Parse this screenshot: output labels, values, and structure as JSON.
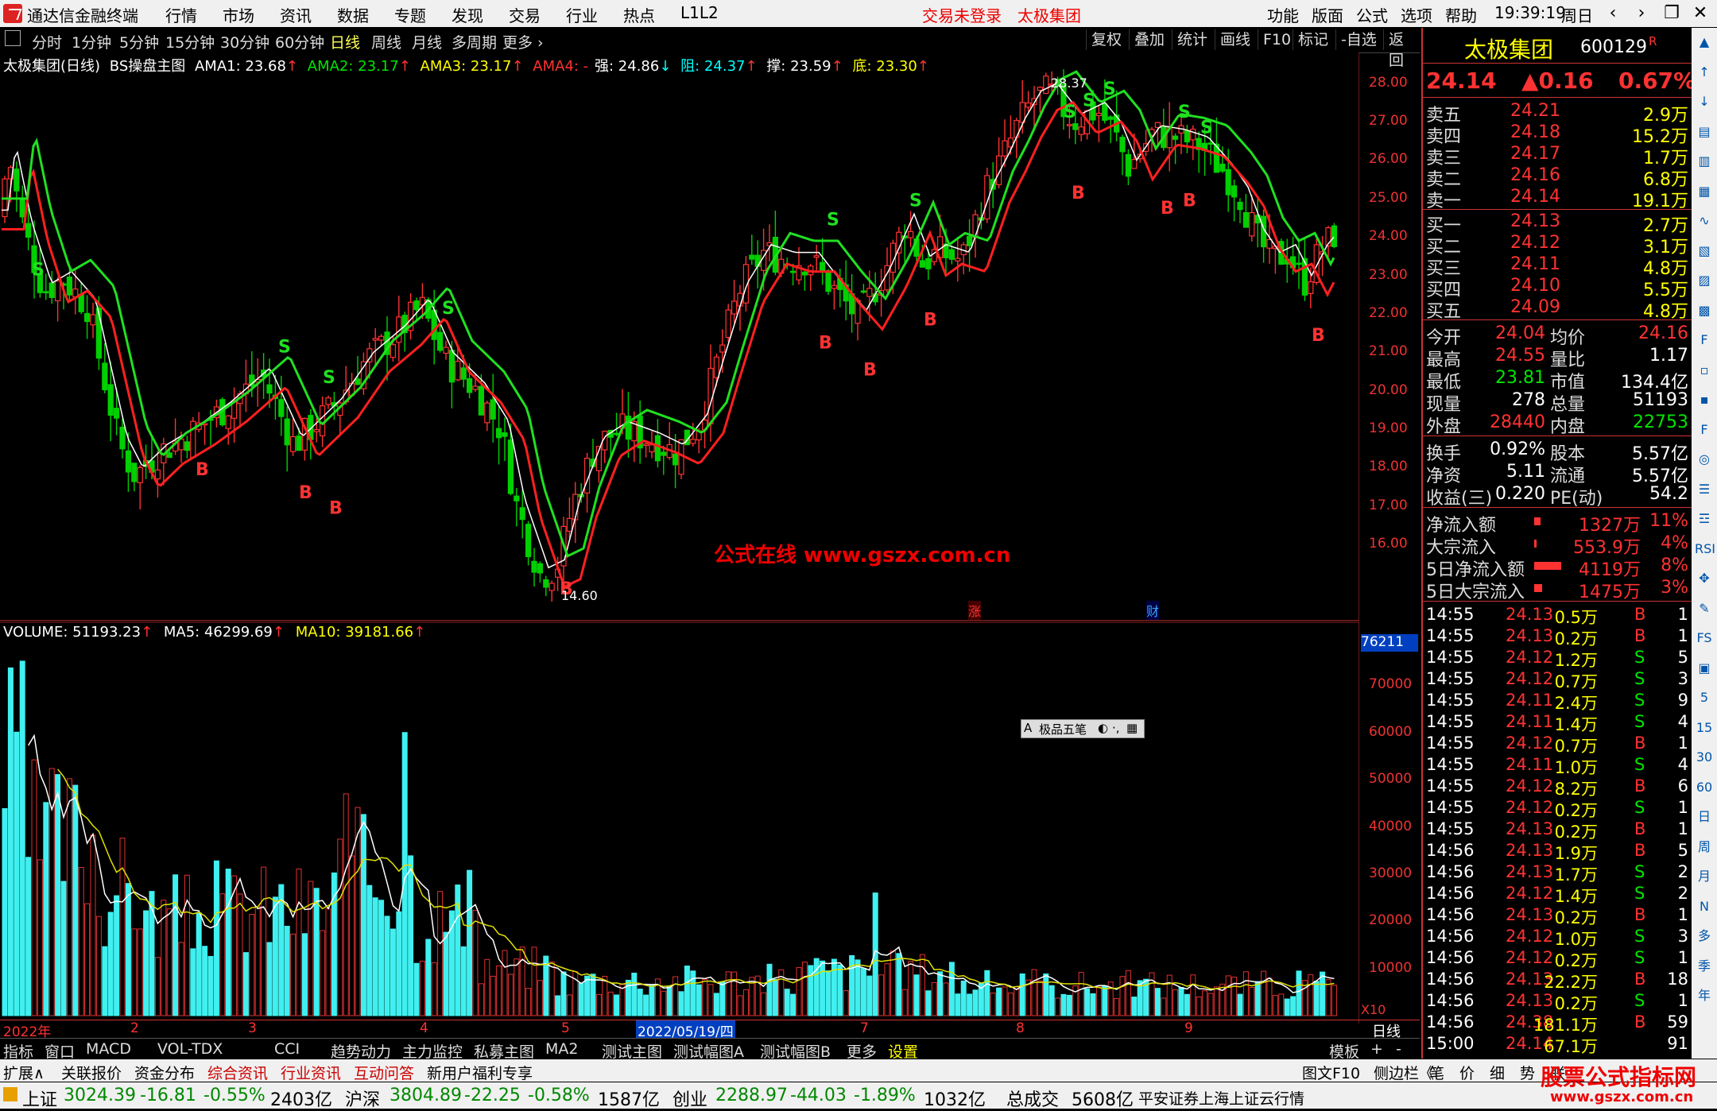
{
  "window": {
    "app_title": "通达信金融终端",
    "menus": [
      "行情",
      "市场",
      "资讯",
      "数据",
      "专题",
      "发现",
      "交易",
      "行业",
      "热点",
      "L1L2"
    ],
    "login_status": "交易未登录",
    "stock_title": "太极集团",
    "right_menus": [
      "功能",
      "版面",
      "公式",
      "选项",
      "帮助"
    ],
    "clock": "19:39:19",
    "weekday": "周日",
    "window_buttons": [
      "‹",
      "›",
      "❐",
      "✕"
    ]
  },
  "toolbar": {
    "periods": [
      "分时",
      "1分钟",
      "5分钟",
      "15分钟",
      "30分钟",
      "60分钟",
      "日线",
      "周线",
      "月线",
      "多周期",
      "更多 ›"
    ],
    "active_period": "日线",
    "right_buttons": [
      "复权",
      "叠加",
      "统计",
      "画线",
      "F10",
      "标记",
      "-自选",
      "返回"
    ]
  },
  "main_chart": {
    "stock_label": "太极集团(日线)",
    "indicator": "BS操盘主图",
    "ama1": "AMA1: 23.68",
    "ama2": "AMA2: 23.17",
    "ama3": "AMA3: 23.17",
    "ama4": "AMA4: -",
    "qiang": "强: 24.86",
    "zu": "阻: 24.37",
    "cheng": "撑: 23.59",
    "di": "底: 23.30",
    "watermark": "公式在线  www.gszx.com.cn",
    "high_label": "28.37",
    "low_label": "14.60",
    "zhang": "涨",
    "cai": "财",
    "yaxis": [
      "28.00",
      "27.00",
      "26.00",
      "25.00",
      "24.00",
      "23.00",
      "22.00",
      "21.00",
      "20.00",
      "19.00",
      "18.00",
      "17.00",
      "16.00"
    ]
  },
  "volume_chart": {
    "volume": "VOLUME: 51193.23",
    "ma5": "MA5: 46299.69",
    "ma10": "MA10: 39181.66",
    "current_tag": "76211",
    "yaxis": [
      "70000",
      "60000",
      "50000",
      "40000",
      "30000",
      "20000",
      "10000"
    ],
    "unit": "X10",
    "ime_bar": "极品五笔"
  },
  "xaxis": {
    "labels": [
      "2022年",
      "2",
      "3",
      "4",
      "5",
      "2022/05/19/四",
      "7",
      "8",
      "9"
    ],
    "right_label": "日线"
  },
  "quote": {
    "name": "太极集团",
    "code": "600129",
    "r_mark": "R",
    "price": "24.14",
    "change": "▲0.16",
    "pct": "0.67%",
    "asks": [
      {
        "label": "卖五",
        "price": "24.21",
        "vol": "2.9万"
      },
      {
        "label": "卖四",
        "price": "24.18",
        "vol": "15.2万"
      },
      {
        "label": "卖三",
        "price": "24.17",
        "vol": "1.7万"
      },
      {
        "label": "卖二",
        "price": "24.16",
        "vol": "6.8万"
      },
      {
        "label": "卖一",
        "price": "24.14",
        "vol": "19.1万"
      }
    ],
    "bids": [
      {
        "label": "买一",
        "price": "24.13",
        "vol": "2.7万"
      },
      {
        "label": "买二",
        "price": "24.12",
        "vol": "3.1万"
      },
      {
        "label": "买三",
        "price": "24.11",
        "vol": "4.8万"
      },
      {
        "label": "买四",
        "price": "24.10",
        "vol": "5.5万"
      },
      {
        "label": "买五",
        "price": "24.09",
        "vol": "4.8万"
      }
    ],
    "stats": [
      {
        "l1": "今开",
        "v1": "24.04",
        "l2": "均价",
        "v2": "24.16"
      },
      {
        "l1": "最高",
        "v1": "24.55",
        "l2": "量比",
        "v2": "1.17"
      },
      {
        "l1": "最低",
        "v1": "23.81",
        "l2": "市值",
        "v2": "134.4亿"
      },
      {
        "l1": "现量",
        "v1": "278",
        "l2": "总量",
        "v2": "51193"
      },
      {
        "l1": "外盘",
        "v1": "28440",
        "l2": "内盘",
        "v2": "22753"
      }
    ],
    "fund": [
      {
        "l1": "换手",
        "v1": "0.92%",
        "l2": "股本",
        "v2": "5.57亿"
      },
      {
        "l1": "净资",
        "v1": "5.11",
        "l2": "流通",
        "v2": "5.57亿"
      },
      {
        "l1": "收益(三)",
        "v1": "0.220",
        "l2": "PE(动)",
        "v2": "54.2"
      }
    ],
    "flows": [
      {
        "label": "净流入额",
        "value": "1327万",
        "pct": "11%"
      },
      {
        "label": "大宗流入",
        "value": "553.9万",
        "pct": "4%"
      },
      {
        "label": "5日净流入额",
        "value": "4119万",
        "pct": "8%"
      },
      {
        "label": "5日大宗流入",
        "value": "1475万",
        "pct": "3%"
      }
    ],
    "ticks": [
      [
        "14:55",
        "24.13",
        "0.5万",
        "B",
        "1"
      ],
      [
        "14:55",
        "24.13",
        "0.2万",
        "B",
        "1"
      ],
      [
        "14:55",
        "24.12",
        "1.2万",
        "S",
        "5"
      ],
      [
        "14:55",
        "24.12",
        "0.7万",
        "S",
        "3"
      ],
      [
        "14:55",
        "24.11",
        "2.4万",
        "S",
        "9"
      ],
      [
        "14:55",
        "24.11",
        "1.4万",
        "S",
        "4"
      ],
      [
        "14:55",
        "24.12",
        "0.7万",
        "B",
        "1"
      ],
      [
        "14:55",
        "24.11",
        "1.0万",
        "S",
        "4"
      ],
      [
        "14:55",
        "24.12",
        "8.2万",
        "B",
        "6"
      ],
      [
        "14:55",
        "24.12",
        "0.2万",
        "S",
        "1"
      ],
      [
        "14:55",
        "24.13",
        "0.2万",
        "B",
        "1"
      ],
      [
        "14:56",
        "24.13",
        "1.9万",
        "B",
        "5"
      ],
      [
        "14:56",
        "24.13",
        "1.7万",
        "S",
        "2"
      ],
      [
        "14:56",
        "24.12",
        "1.4万",
        "S",
        "2"
      ],
      [
        "14:56",
        "24.13",
        "0.2万",
        "B",
        "1"
      ],
      [
        "14:56",
        "24.12",
        "1.0万",
        "S",
        "3"
      ],
      [
        "14:56",
        "24.12",
        "0.2万",
        "S",
        "1"
      ],
      [
        "14:56",
        "24.13",
        "22.2万",
        "B",
        "18"
      ],
      [
        "14:56",
        "24.13",
        "0.2万",
        "S",
        "1"
      ],
      [
        "14:56",
        "24.38",
        "181.1万",
        "B",
        "59"
      ],
      [
        "15:00",
        "24.14",
        "67.1万",
        "",
        "91"
      ]
    ]
  },
  "icon_strip": [
    "▲",
    "↑",
    "↓",
    "▤",
    "▥",
    "▦",
    "∿",
    "▧",
    "▨",
    "▩",
    "F",
    "▫",
    "▪",
    "F",
    "◎",
    "☰",
    "☲",
    "RSI",
    "✥",
    "✎",
    "FS",
    "▣",
    "5",
    "15",
    "30",
    "60",
    "日",
    "周",
    "月",
    "N",
    "多",
    "季",
    "年"
  ],
  "bottom_tabs1": [
    "指标",
    "窗口",
    "MACD",
    "VOL-TDX",
    "CCI",
    "趋势动力",
    "主力监控",
    "私募主图",
    "MA2",
    "测试主图",
    "测试幅图A",
    "测试幅图B",
    "更多",
    "设置"
  ],
  "bottom_tabs1_right": [
    "模板",
    "+",
    "-"
  ],
  "bottom_tabs2": [
    "扩展∧",
    "关联报价",
    "资金分布",
    "综合资讯",
    "行业资讯",
    "互动问答",
    "新用户福利专享"
  ],
  "bottom_tabs2_right": [
    "图文F10",
    "侧边栏《",
    "笔",
    "价",
    "细",
    "势",
    "联"
  ],
  "status_bar": {
    "sh_label": "上证",
    "sh_val": "3024.39",
    "sh_chg": "-16.81",
    "sh_pct": "-0.55%",
    "sh_amt": "2403亿",
    "hs_label": "沪深",
    "hs_val": "3804.89",
    "hs_chg": "-22.25",
    "hs_pct": "-0.58%",
    "hs_amt": "1587亿",
    "cy_label": "创业",
    "cy_val": "2288.97",
    "cy_chg": "-44.03",
    "cy_pct": "-1.89%",
    "cy_amt": "1032亿",
    "total_label": "总成交",
    "total_val": "5608亿",
    "broker": "平安证券上海上证云行情",
    "brand": "股票公式指标网",
    "brand_url": "www.gszx.com.cn"
  },
  "chart_data": {
    "type": "candlestick",
    "price_axis_range": [
      14.0,
      28.8
    ],
    "volume_axis_range": [
      0,
      80000
    ],
    "high": 28.37,
    "low": 14.6,
    "last_close": 24.14
  }
}
